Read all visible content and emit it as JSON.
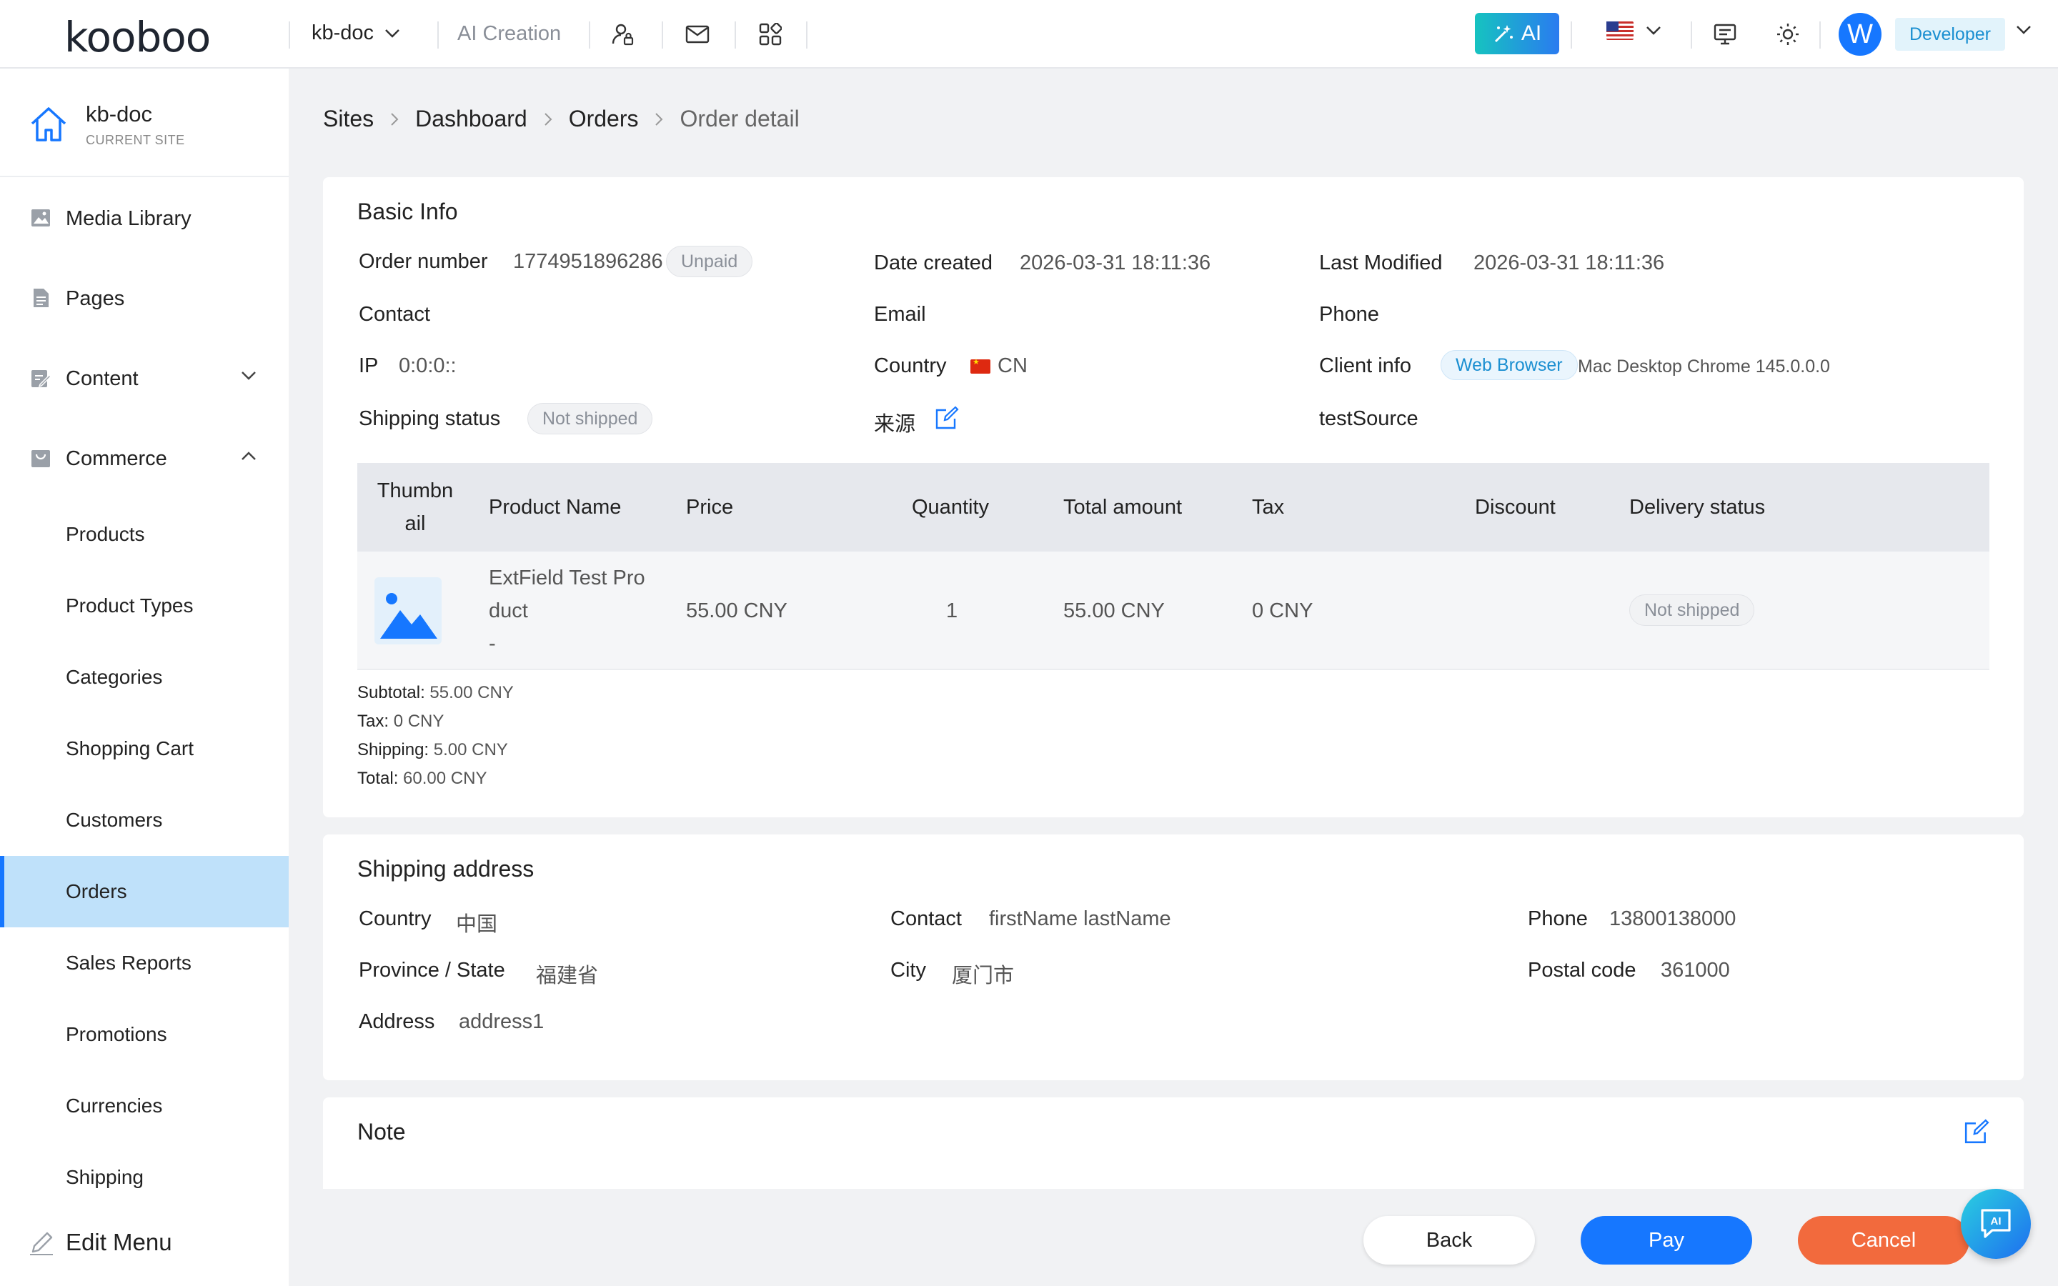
{
  "topbar": {
    "logo": "kooboo",
    "site": "kb-doc",
    "ai_creation": "AI Creation",
    "ai_button": "AI",
    "user_initial": "W",
    "role": "Developer"
  },
  "sidebar": {
    "current_site": {
      "name": "kb-doc",
      "caption": "CURRENT SITE"
    },
    "items": [
      {
        "label": "Media Library",
        "icon": "image-icon"
      },
      {
        "label": "Pages",
        "icon": "document-icon"
      },
      {
        "label": "Content",
        "icon": "edit-document-icon"
      },
      {
        "label": "Commerce",
        "icon": "shopping-bag-icon"
      }
    ],
    "commerce_items": [
      "Products",
      "Product Types",
      "Categories",
      "Shopping Cart",
      "Customers",
      "Orders",
      "Sales Reports",
      "Promotions",
      "Currencies",
      "Shipping"
    ],
    "active_item": "Orders",
    "edit_menu": "Edit Menu"
  },
  "breadcrumb": [
    "Sites",
    "Dashboard",
    "Orders",
    "Order detail"
  ],
  "basic_info": {
    "title": "Basic Info",
    "order_number_label": "Order number",
    "order_number": "1774951896286",
    "payment_status": "Unpaid",
    "date_created_label": "Date created",
    "date_created": "2026-03-31 18:11:36",
    "last_modified_label": "Last Modified",
    "last_modified": "2026-03-31 18:11:36",
    "contact_label": "Contact",
    "email_label": "Email",
    "phone_label": "Phone",
    "ip_label": "IP",
    "ip": "0:0:0::",
    "country_label": "Country",
    "country": "CN",
    "client_info_label": "Client info",
    "client_type": "Web Browser",
    "client_detail": "Mac Desktop Chrome 145.0.0.0",
    "shipping_status_label": "Shipping status",
    "shipping_status": "Not shipped",
    "source_label": "来源",
    "source_value": "testSource"
  },
  "items_table": {
    "headers": {
      "thumbnail_1": "Thumbn",
      "thumbnail_2": "ail",
      "product_name": "Product Name",
      "price": "Price",
      "quantity": "Quantity",
      "total_amount": "Total amount",
      "tax": "Tax",
      "discount": "Discount",
      "delivery_status": "Delivery status"
    },
    "row": {
      "product_name_1": "ExtField Test Pro",
      "product_name_2": "duct",
      "variant": "-",
      "price": "55.00 CNY",
      "quantity": "1",
      "total_amount": "55.00 CNY",
      "tax": "0 CNY",
      "discount": "",
      "delivery_status": "Not shipped"
    }
  },
  "totals": {
    "subtotal_label": "Subtotal:",
    "subtotal": "55.00 CNY",
    "tax_label": "Tax:",
    "tax": "0 CNY",
    "shipping_label": "Shipping:",
    "shipping": "5.00 CNY",
    "total_label": "Total:",
    "total": "60.00 CNY"
  },
  "shipping_address": {
    "title": "Shipping address",
    "country_label": "Country",
    "country": "中国",
    "contact_label": "Contact",
    "contact": "firstName lastName",
    "phone_label": "Phone",
    "phone": "13800138000",
    "province_label": "Province / State",
    "province": "福建省",
    "city_label": "City",
    "city": "厦门市",
    "postal_label": "Postal code",
    "postal": "361000",
    "address_label": "Address",
    "address": "address1"
  },
  "note": {
    "title": "Note"
  },
  "actions": {
    "back": "Back",
    "pay": "Pay",
    "cancel": "Cancel"
  },
  "chat": {
    "label": "AI"
  },
  "colors": {
    "primary": "#1677ff",
    "cancel": "#f26a3d",
    "active_bg": "#bfe1fa"
  }
}
